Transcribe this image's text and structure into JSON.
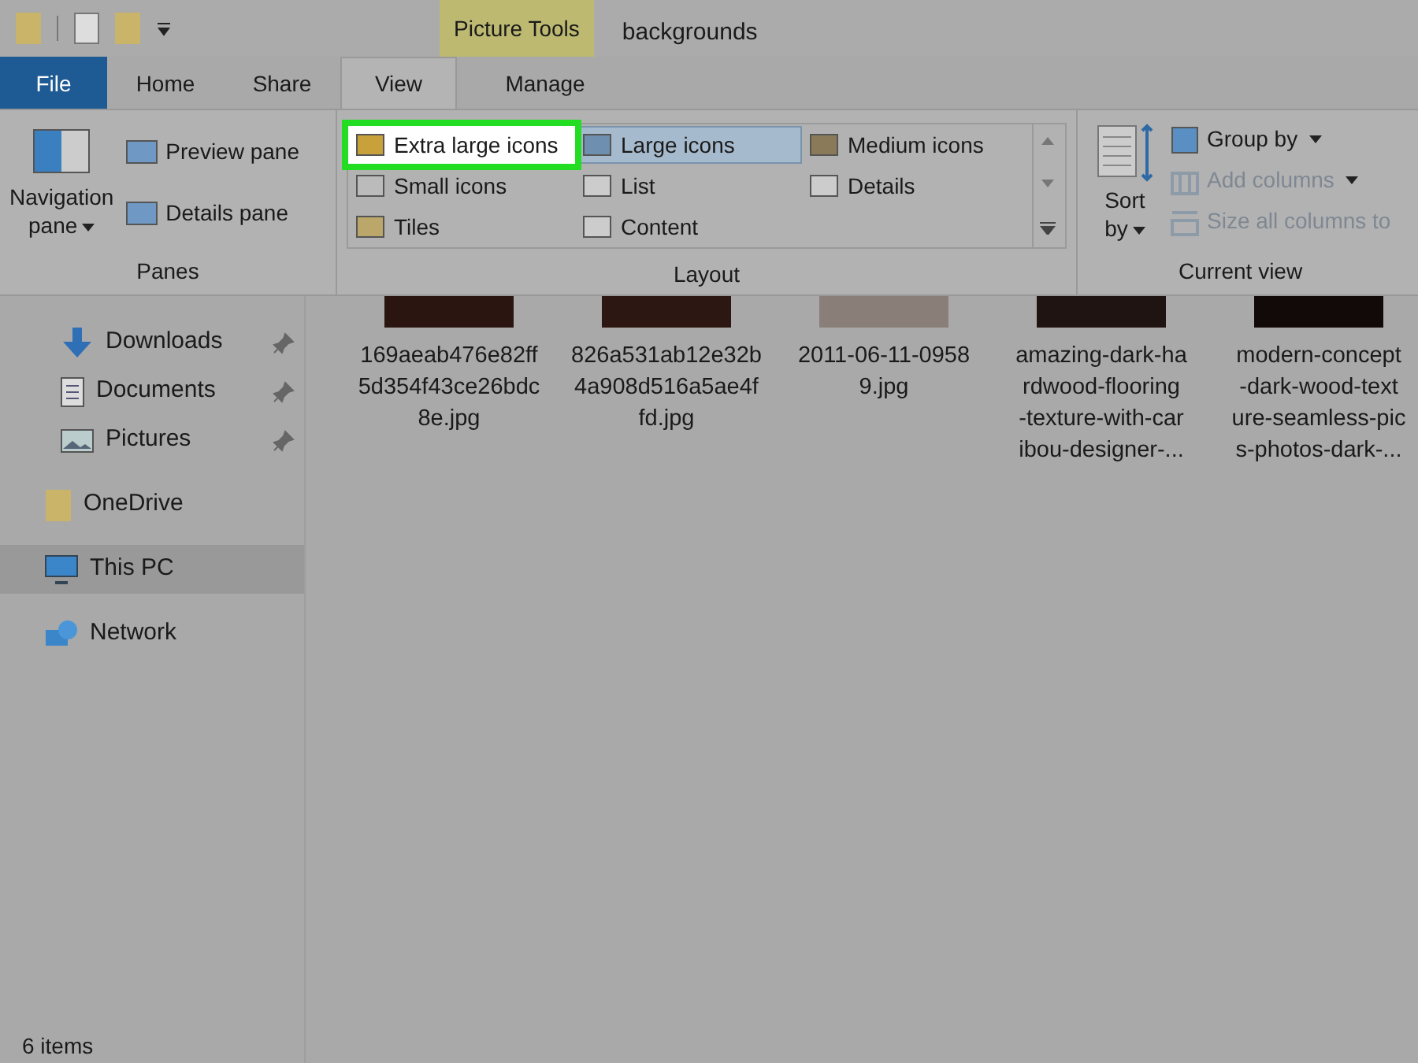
{
  "window": {
    "title": "backgrounds",
    "context_tab": "Picture Tools"
  },
  "tabs": [
    {
      "label": "File",
      "kind": "file",
      "selected": false
    },
    {
      "label": "Home",
      "kind": "tab",
      "selected": false
    },
    {
      "label": "Share",
      "kind": "tab",
      "selected": false
    },
    {
      "label": "View",
      "kind": "tab",
      "selected": true
    },
    {
      "label": "Manage",
      "kind": "context",
      "selected": false
    }
  ],
  "panes": {
    "navigation": "Navigation",
    "navigation_2": "pane",
    "items": [
      "Preview pane",
      "Details pane"
    ],
    "group": "Panes"
  },
  "layout": {
    "group": "Layout",
    "items": [
      {
        "label": "Extra large icons",
        "kind": "xl",
        "selected": false,
        "highlighted": true
      },
      {
        "label": "Small icons",
        "kind": "small",
        "selected": false,
        "highlighted": false
      },
      {
        "label": "Tiles",
        "kind": "tiles",
        "selected": false,
        "highlighted": false
      },
      {
        "label": "Large icons",
        "kind": "large",
        "selected": true,
        "highlighted": false
      },
      {
        "label": "List",
        "kind": "list",
        "selected": false,
        "highlighted": false
      },
      {
        "label": "Content",
        "kind": "content",
        "selected": false,
        "highlighted": false
      },
      {
        "label": "Medium icons",
        "kind": "medium",
        "selected": false,
        "highlighted": false
      },
      {
        "label": "Details",
        "kind": "details",
        "selected": false,
        "highlighted": false
      }
    ]
  },
  "current_view": {
    "group": "Current view",
    "sort": "Sort",
    "sort_2": "by",
    "items": [
      {
        "label": "Group by",
        "kind": "group",
        "disabled": false
      },
      {
        "label": "Add columns",
        "kind": "add",
        "disabled": true
      },
      {
        "label": "Size all columns to",
        "kind": "size",
        "disabled": true
      }
    ]
  },
  "sidebar": {
    "items": [
      {
        "label": "Downloads",
        "kind": "downloads",
        "pinned": true,
        "selected": false
      },
      {
        "label": "Documents",
        "kind": "documents",
        "pinned": true,
        "selected": false
      },
      {
        "label": "Pictures",
        "kind": "pictures",
        "pinned": true,
        "selected": false
      },
      {
        "label": "OneDrive",
        "kind": "folder",
        "pinned": false,
        "selected": false
      },
      {
        "label": "This PC",
        "kind": "pc",
        "pinned": false,
        "selected": true
      },
      {
        "label": "Network",
        "kind": "network",
        "pinned": false,
        "selected": false
      }
    ]
  },
  "files": [
    {
      "name_lines": [
        "169aeab476e82ff",
        "5d354f43ce26bdc",
        "8e.jpg"
      ],
      "color": "#2a1510"
    },
    {
      "name_lines": [
        "826a531ab12e32b",
        "4a908d516a5ae4f",
        "fd.jpg"
      ],
      "color": "#2c1712"
    },
    {
      "name_lines": [
        "2011-06-11-0958",
        "9.jpg"
      ],
      "color": "#8a7f78"
    },
    {
      "name_lines": [
        "amazing-dark-ha",
        "rdwood-flooring",
        "-texture-with-car",
        "ibou-designer-..."
      ],
      "color": "#201412"
    },
    {
      "name_lines": [
        "modern-concept",
        "-dark-wood-text",
        "ure-seamless-pic",
        "s-photos-dark-..."
      ],
      "color": "#120a08"
    }
  ],
  "status_bar": {
    "count": "6 items"
  }
}
